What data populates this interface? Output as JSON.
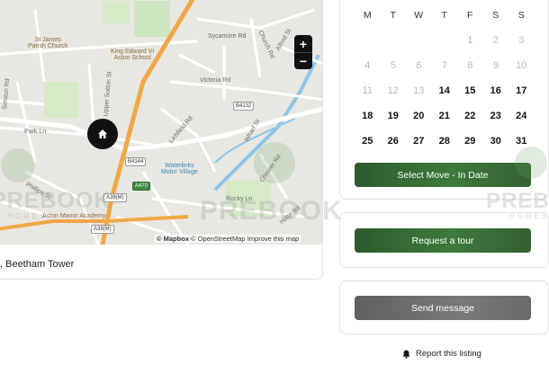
{
  "map": {
    "labels": {
      "church": "St James\nParish Church",
      "school": "King Edward VI\nAston School",
      "sycamore": "Sycamore Rd",
      "church_rd": "Church Rd",
      "alfred": "Alfred St",
      "victoria": "Victoria Rd",
      "park": "Park Ln",
      "lichfield": "Lichfield Rd",
      "wharf": "Wharf St",
      "chester": "Chester Rd",
      "upper_sutton": "Upper Sutton St",
      "selston": "Selston Rd",
      "phillips": "Phillips St",
      "waterlinks": "Waterlinks\nMotor Village",
      "rocky": "Rocky Ln",
      "aston_manor": "Aston Manor Academy",
      "holte": "Holte Rd"
    },
    "shields": {
      "b4132": "B4132",
      "b4144": "B4144",
      "a38m_1": "A38(M)",
      "a38m_2": "A38(M)",
      "a470": "A470"
    },
    "zoom_in": "+",
    "zoom_out": "−",
    "attribution_mapbox": "© Mapbox",
    "attribution_osm": "© OpenStreetMap",
    "attribution_improve": "Improve this map",
    "address": ", Beetham Tower"
  },
  "calendar": {
    "weekdays": [
      "M",
      "T",
      "W",
      "T",
      "F",
      "S",
      "S"
    ],
    "cells": [
      {
        "d": "",
        "s": "off"
      },
      {
        "d": "",
        "s": "off"
      },
      {
        "d": "",
        "s": "off"
      },
      {
        "d": "",
        "s": "off"
      },
      {
        "d": "1",
        "s": "off"
      },
      {
        "d": "2",
        "s": "off"
      },
      {
        "d": "3",
        "s": "off"
      },
      {
        "d": "4",
        "s": "off"
      },
      {
        "d": "5",
        "s": "off"
      },
      {
        "d": "6",
        "s": "off"
      },
      {
        "d": "7",
        "s": "off"
      },
      {
        "d": "8",
        "s": "off"
      },
      {
        "d": "9",
        "s": "off"
      },
      {
        "d": "10",
        "s": "off"
      },
      {
        "d": "11",
        "s": "off"
      },
      {
        "d": "12",
        "s": "off"
      },
      {
        "d": "13",
        "s": "off"
      },
      {
        "d": "14",
        "s": "on"
      },
      {
        "d": "15",
        "s": "on"
      },
      {
        "d": "16",
        "s": "on"
      },
      {
        "d": "17",
        "s": "on"
      },
      {
        "d": "18",
        "s": "on"
      },
      {
        "d": "19",
        "s": "on"
      },
      {
        "d": "20",
        "s": "on"
      },
      {
        "d": "21",
        "s": "on"
      },
      {
        "d": "22",
        "s": "on"
      },
      {
        "d": "23",
        "s": "on"
      },
      {
        "d": "24",
        "s": "on"
      },
      {
        "d": "25",
        "s": "on"
      },
      {
        "d": "26",
        "s": "on"
      },
      {
        "d": "27",
        "s": "on"
      },
      {
        "d": "28",
        "s": "on"
      },
      {
        "d": "29",
        "s": "on"
      },
      {
        "d": "30",
        "s": "on"
      },
      {
        "d": "31",
        "s": "on"
      }
    ],
    "select_label": "Select Move - In Date"
  },
  "actions": {
    "tour_label": "Request a tour",
    "message_label": "Send message",
    "report_label": "Report this listing"
  },
  "watermark": {
    "brand": "PREBOOK",
    "sub": "HOMES"
  },
  "colors": {
    "primary_green": "#3e7a3c",
    "dark_green": "#2c5a2e",
    "gray_button": "#6a6a6a",
    "map_bg": "#e9e7e2",
    "motorway": "#f0a848",
    "water": "#8fc6ea"
  },
  "icons": {
    "pin": "home-icon",
    "report": "bell-icon"
  }
}
